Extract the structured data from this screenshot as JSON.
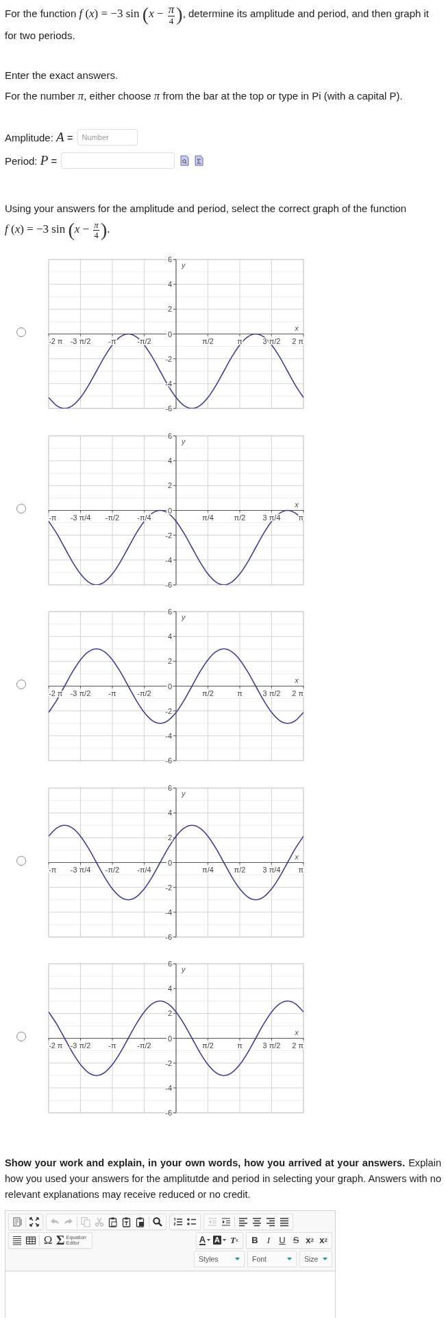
{
  "question": {
    "before": "For the function",
    "formula": {
      "head": "*f* (*x*) = −3 sin",
      "open": "(",
      "inner": "*x* −",
      "numerator": "*π*",
      "denominator": "4",
      "close": ")"
    },
    "after": ", determine its amplitude and period, and then graph it for two periods."
  },
  "instructions": [
    "Enter the exact answers.",
    "For the number *π*, either choose *π* from the bar at the top or type in Pi (with a capital P)."
  ],
  "answers": [
    {
      "label": "Amplitude: *A* =",
      "placeholder": "Number",
      "kind": "short"
    },
    {
      "label": "Period: *P* =",
      "kind": "long"
    }
  ],
  "graph_prompt": {
    "text": "Using your answers for the amplitude and period, select the correct graph of the function",
    "formula": {
      "head": "*f* (*x*) = −3 sin",
      "open": "(",
      "inner": "*x* −",
      "numerator": "*π*",
      "denominator": "4",
      "close": ")",
      "after": "."
    }
  },
  "choices": [
    {
      "selected": false,
      "chart_data": {
        "type": "line",
        "xlabel": "x",
        "ylabel": "y",
        "xlim": [
          -6.283,
          6.283
        ],
        "ylim": [
          -6,
          6
        ],
        "yticks": [
          -6,
          -4,
          -2,
          0,
          2,
          4,
          6
        ],
        "xticks": [
          {
            "value": -6.283,
            "label": "-2 π"
          },
          {
            "value": -4.712,
            "label": "-3 π/2"
          },
          {
            "value": -3.142,
            "label": "-π"
          },
          {
            "value": -1.571,
            "label": "-π/2"
          },
          {
            "value": 1.571,
            "label": "π/2"
          },
          {
            "value": 3.142,
            "label": "π"
          },
          {
            "value": 4.712,
            "label": "3 π/2"
          },
          {
            "value": 6.283,
            "label": "2 π"
          }
        ],
        "x": [
          -6.283,
          -5.89,
          -5.498,
          -5.105,
          -4.712,
          -4.32,
          -3.927,
          -3.534,
          -3.142,
          -2.749,
          -2.356,
          -1.963,
          -1.571,
          -1.178,
          -0.785,
          -0.393,
          0,
          0.393,
          0.785,
          1.178,
          1.571,
          1.963,
          2.356,
          2.749,
          3.142,
          3.534,
          3.927,
          4.32,
          4.712,
          5.105,
          5.498,
          5.89,
          6.283
        ],
        "series": [
          {
            "color": "#3d3d96",
            "values": [
              -5.12,
              -5.77,
              -6,
              -5.77,
              -5.12,
              -4.15,
              -3,
              -1.85,
              -0.88,
              -0.23,
              0,
              -0.23,
              -0.88,
              -1.85,
              -3,
              -4.15,
              -5.12,
              -5.77,
              -6,
              -5.77,
              -5.12,
              -4.15,
              -3,
              -1.85,
              -0.88,
              -0.23,
              0,
              -0.23,
              -0.88,
              -1.85,
              -3,
              -4.15,
              -5.12
            ]
          }
        ],
        "grid": true
      }
    },
    {
      "selected": false,
      "chart_data": {
        "type": "line",
        "xlabel": "x",
        "ylabel": "y",
        "xlim": [
          -3.142,
          3.142
        ],
        "ylim": [
          -6,
          6
        ],
        "yticks": [
          -6,
          -4,
          -2,
          0,
          2,
          4,
          6
        ],
        "xticks": [
          {
            "value": -3.142,
            "label": "-π"
          },
          {
            "value": -2.356,
            "label": "-3 π/4"
          },
          {
            "value": -1.571,
            "label": "-π/2"
          },
          {
            "value": -0.785,
            "label": "-π/4"
          },
          {
            "value": 0.785,
            "label": "π/4"
          },
          {
            "value": 1.571,
            "label": "π/2"
          },
          {
            "value": 2.356,
            "label": "3 π/4"
          },
          {
            "value": 3.142,
            "label": "π"
          }
        ],
        "x": [
          -3.142,
          -2.945,
          -2.749,
          -2.553,
          -2.356,
          -2.16,
          -1.963,
          -1.767,
          -1.571,
          -1.374,
          -1.178,
          -0.982,
          -0.785,
          -0.589,
          -0.393,
          -0.196,
          0,
          0.196,
          0.393,
          0.589,
          0.785,
          0.982,
          1.178,
          1.374,
          1.571,
          1.767,
          1.963,
          2.16,
          2.356,
          2.553,
          2.749,
          2.945,
          3.142
        ],
        "series": [
          {
            "color": "#3d3d96",
            "values": [
              -0.88,
              -1.85,
              -3,
              -4.15,
              -5.12,
              -5.77,
              -6,
              -5.77,
              -5.12,
              -4.15,
              -3,
              -1.85,
              -0.88,
              -0.23,
              0,
              -0.23,
              -0.88,
              -1.85,
              -3,
              -4.15,
              -5.12,
              -5.77,
              -6,
              -5.77,
              -5.12,
              -4.15,
              -3,
              -1.85,
              -0.88,
              -0.23,
              0,
              -0.23,
              -0.88
            ]
          }
        ],
        "grid": true
      }
    },
    {
      "selected": false,
      "chart_data": {
        "type": "line",
        "xlabel": "x",
        "ylabel": "y",
        "xlim": [
          -6.283,
          6.283
        ],
        "ylim": [
          -6,
          6
        ],
        "yticks": [
          -6,
          -4,
          -2,
          0,
          2,
          4,
          6
        ],
        "xticks": [
          {
            "value": -6.283,
            "label": "-2 π"
          },
          {
            "value": -4.712,
            "label": "-3 π/2"
          },
          {
            "value": -3.142,
            "label": "-π"
          },
          {
            "value": -1.571,
            "label": "-π/2"
          },
          {
            "value": 1.571,
            "label": "π/2"
          },
          {
            "value": 3.142,
            "label": "π"
          },
          {
            "value": 4.712,
            "label": "3 π/2"
          },
          {
            "value": 6.283,
            "label": "2 π"
          }
        ],
        "x": [
          -6.283,
          -5.89,
          -5.498,
          -5.105,
          -4.712,
          -4.32,
          -3.927,
          -3.534,
          -3.142,
          -2.749,
          -2.356,
          -1.963,
          -1.571,
          -1.178,
          -0.785,
          -0.393,
          0,
          0.393,
          0.785,
          1.178,
          1.571,
          1.963,
          2.356,
          2.749,
          3.142,
          3.534,
          3.927,
          4.32,
          4.712,
          5.105,
          5.498,
          5.89,
          6.283
        ],
        "series": [
          {
            "color": "#3d3d96",
            "values": [
              -2.12,
              -1.15,
              0,
              1.15,
              2.12,
              2.77,
              3,
              2.77,
              2.12,
              1.15,
              0,
              -1.15,
              -2.12,
              -2.77,
              -3,
              -2.77,
              -2.12,
              -1.15,
              0,
              1.15,
              2.12,
              2.77,
              3,
              2.77,
              2.12,
              1.15,
              0,
              -1.15,
              -2.12,
              -2.77,
              -3,
              -2.77,
              -2.12
            ]
          }
        ],
        "grid": true
      }
    },
    {
      "selected": false,
      "chart_data": {
        "type": "line",
        "xlabel": "x",
        "ylabel": "y",
        "xlim": [
          -3.142,
          3.142
        ],
        "ylim": [
          -6,
          6
        ],
        "yticks": [
          -6,
          -4,
          -2,
          0,
          2,
          4,
          6
        ],
        "xticks": [
          {
            "value": -3.142,
            "label": "-π"
          },
          {
            "value": -2.356,
            "label": "-3 π/4"
          },
          {
            "value": -1.571,
            "label": "-π/2"
          },
          {
            "value": -0.785,
            "label": "-π/4"
          },
          {
            "value": 0.785,
            "label": "π/4"
          },
          {
            "value": 1.571,
            "label": "π/2"
          },
          {
            "value": 2.356,
            "label": "3 π/4"
          },
          {
            "value": 3.142,
            "label": "π"
          }
        ],
        "x": [
          -3.142,
          -2.945,
          -2.749,
          -2.553,
          -2.356,
          -2.16,
          -1.963,
          -1.767,
          -1.571,
          -1.374,
          -1.178,
          -0.982,
          -0.785,
          -0.589,
          -0.393,
          -0.196,
          0,
          0.196,
          0.393,
          0.589,
          0.785,
          0.982,
          1.178,
          1.374,
          1.571,
          1.767,
          1.963,
          2.16,
          2.356,
          2.553,
          2.749,
          2.945,
          3.142
        ],
        "series": [
          {
            "color": "#3d3d96",
            "values": [
              2.12,
              2.77,
              3,
              2.77,
              2.12,
              1.15,
              0,
              -1.15,
              -2.12,
              -2.77,
              -3,
              -2.77,
              -2.12,
              -1.15,
              0,
              1.15,
              2.12,
              2.77,
              3,
              2.77,
              2.12,
              1.15,
              0,
              -1.15,
              -2.12,
              -2.77,
              -3,
              -2.77,
              -2.12,
              -1.15,
              0,
              1.15,
              2.12
            ]
          }
        ],
        "grid": true
      }
    },
    {
      "selected": false,
      "chart_data": {
        "type": "line",
        "xlabel": "x",
        "ylabel": "y",
        "xlim": [
          -6.283,
          6.283
        ],
        "ylim": [
          -6,
          6
        ],
        "yticks": [
          -6,
          -4,
          -2,
          0,
          2,
          4,
          6
        ],
        "xticks": [
          {
            "value": -6.283,
            "label": "-2 π"
          },
          {
            "value": -4.712,
            "label": "-3 π/2"
          },
          {
            "value": -3.142,
            "label": "-π"
          },
          {
            "value": -1.571,
            "label": "-π/2"
          },
          {
            "value": 1.571,
            "label": "π/2"
          },
          {
            "value": 3.142,
            "label": "π"
          },
          {
            "value": 4.712,
            "label": "3 π/2"
          },
          {
            "value": 6.283,
            "label": "2 π"
          }
        ],
        "x": [
          -6.283,
          -5.89,
          -5.498,
          -5.105,
          -4.712,
          -4.32,
          -3.927,
          -3.534,
          -3.142,
          -2.749,
          -2.356,
          -1.963,
          -1.571,
          -1.178,
          -0.785,
          -0.393,
          0,
          0.393,
          0.785,
          1.178,
          1.571,
          1.963,
          2.356,
          2.749,
          3.142,
          3.534,
          3.927,
          4.32,
          4.712,
          5.105,
          5.498,
          5.89,
          6.283
        ],
        "series": [
          {
            "color": "#3d3d96",
            "values": [
              2.12,
              1.15,
              0,
              -1.15,
              -2.12,
              -2.77,
              -3,
              -2.77,
              -2.12,
              -1.15,
              0,
              1.15,
              2.12,
              2.77,
              3,
              2.77,
              2.12,
              1.15,
              0,
              -1.15,
              -2.12,
              -2.77,
              -3,
              -2.77,
              -2.12,
              -1.15,
              0,
              1.15,
              2.12,
              2.77,
              3,
              2.77,
              2.12
            ]
          }
        ],
        "grid": true
      }
    }
  ],
  "explanation_prompt": "**Show your work and explain, in your own words, how you arrived at your answers.** Explain how you used your answers for the amplitutde and period in selecting your graph. Answers with no relevant explanations may receive reduced or no credit.",
  "editor": {
    "toolbar_rows": [
      {
        "left": [
          [
            [
              {
                "kind": "source",
                "disabled": false
              }
            ],
            [
              {
                "kind": "maximize",
                "disabled": false
              }
            ]
          ],
          [
            [
              {
                "kind": "undo",
                "disabled": true
              },
              {
                "kind": "redo",
                "disabled": true
              }
            ],
            [
              {
                "kind": "copy",
                "disabled": true
              },
              {
                "kind": "cut",
                "disabled": true
              },
              {
                "kind": "paste",
                "disabled": false
              },
              {
                "kind": "paste-text",
                "disabled": false
              },
              {
                "kind": "paste-word",
                "disabled": false
              }
            ],
            [
              {
                "kind": "find",
                "disabled": false
              }
            ]
          ],
          [
            [
              {
                "kind": "numbered-list",
                "disabled": false
              },
              {
                "kind": "bulleted-list",
                "disabled": false
              }
            ]
          ],
          [
            [
              {
                "kind": "outdent",
                "disabled": true
              },
              {
                "kind": "indent",
                "disabled": false
              }
            ],
            [
              {
                "kind": "align-left",
                "disabled": false
              },
              {
                "kind": "align-center",
                "disabled": false
              },
              {
                "kind": "align-right",
                "disabled": false
              },
              {
                "kind": "justify",
                "disabled": false
              }
            ]
          ]
        ],
        "right": []
      },
      {
        "left": [
          [
            [
              {
                "kind": "lines",
                "disabled": false
              },
              {
                "kind": "table",
                "disabled": false
              }
            ],
            [
              {
                "kind": "special-char",
                "label": "Ω",
                "disabled": false
              },
              {
                "kind": "equation",
                "label": "Σ",
                "caption": "Equation Editor",
                "disabled": false
              }
            ]
          ]
        ],
        "right": [
          [
            [
              {
                "kind": "text-color",
                "label": "A",
                "disabled": false
              },
              {
                "kind": "bg-color",
                "label": "A",
                "disabled": false
              },
              {
                "kind": "remove-format",
                "label": "T",
                "index": "x",
                "disabled": false
              }
            ]
          ],
          [
            [
              {
                "kind": "bold",
                "label": "B",
                "disabled": false
              },
              {
                "kind": "italic",
                "label": "I",
                "disabled": false
              },
              {
                "kind": "underline",
                "label": "U",
                "disabled": false
              },
              {
                "kind": "strike",
                "label": "S",
                "disabled": false
              },
              {
                "kind": "subscript",
                "label": "x",
                "index": "2",
                "disabled": false
              },
              {
                "kind": "superscript",
                "label": "x",
                "index": "2",
                "disabled": false
              }
            ]
          ]
        ]
      }
    ],
    "combos": [
      {
        "label": "Styles"
      },
      {
        "label": "Font"
      },
      {
        "label": "Size"
      }
    ]
  }
}
